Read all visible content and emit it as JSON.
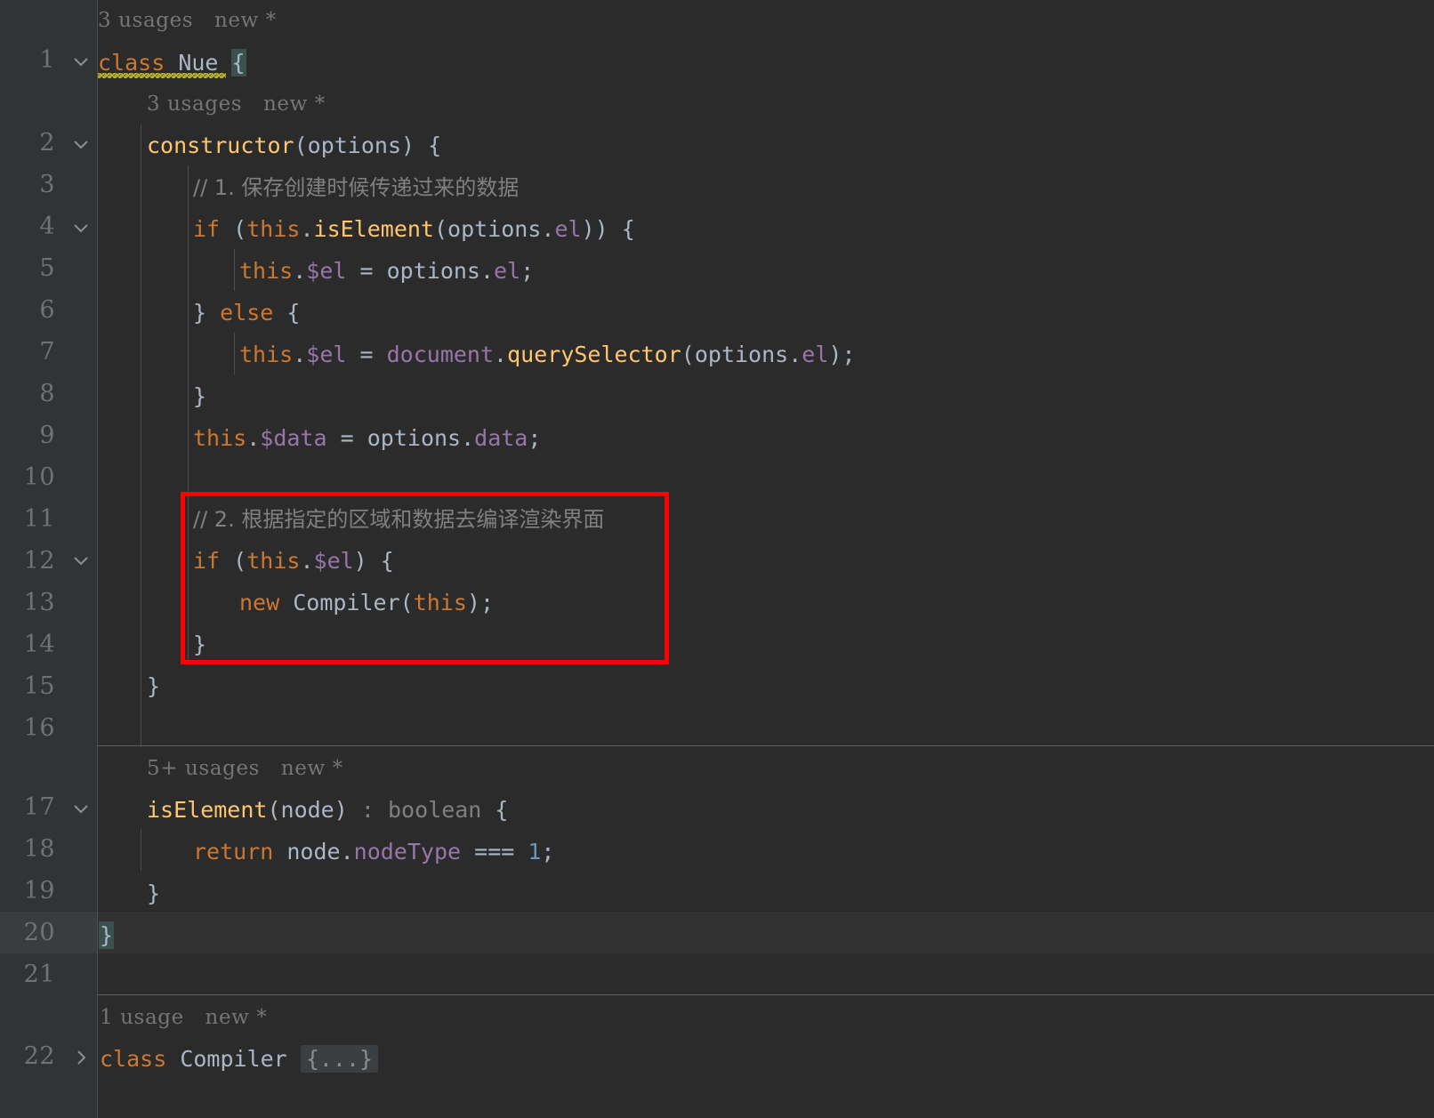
{
  "editor": {
    "theme": "darcula",
    "background_color": "#2b2b2b",
    "gutter_color": "#313335",
    "caret_line_color": "#323232",
    "annotation_color": "#fe0000",
    "language": "javascript"
  },
  "gutter": {
    "line_numbers": [
      "1",
      "2",
      "3",
      "4",
      "5",
      "6",
      "7",
      "8",
      "9",
      "10",
      "11",
      "12",
      "13",
      "14",
      "15",
      "16",
      "17",
      "18",
      "19",
      "20",
      "21",
      "22"
    ],
    "fold_expanded_lines": [
      "1",
      "2",
      "4",
      "12",
      "17"
    ],
    "fold_collapsed_lines": [
      "22"
    ]
  },
  "inlay_hints": [
    {
      "id": "hint-class-nue",
      "usages": "3 usages",
      "new": "new *"
    },
    {
      "id": "hint-constructor",
      "usages": "3 usages",
      "new": "new *"
    },
    {
      "id": "hint-iselement",
      "usages": "5+ usages",
      "new": "new *"
    },
    {
      "id": "hint-class-compiler",
      "usages": "1 usage",
      "new": "new *"
    }
  ],
  "code_lines": {
    "l1": "class Nue {",
    "l2": "constructor(options) {",
    "l3": "// 1. 保存创建时候传递过来的数据",
    "l4": "if (this.isElement(options.el)) {",
    "l5": "this.$el = options.el;",
    "l6": "} else {",
    "l7": "this.$el = document.querySelector(options.el);",
    "l8": "}",
    "l9": "this.$data = options.data;",
    "l10": "",
    "l11": "// 2. 根据指定的区域和数据去编译渲染界面",
    "l12": "if (this.$el) {",
    "l13": "new Compiler(this);",
    "l14": "}",
    "l15": "}",
    "l16": "",
    "l17": "isElement(node) : boolean {",
    "l18": "return node.nodeType === 1;",
    "l19": "}",
    "l20": "}",
    "l21": "",
    "l22": "class Compiler {...}"
  },
  "tokens": {
    "kw_class": "class",
    "kw_if": "if",
    "kw_else": "else",
    "kw_new": "new",
    "kw_return": "return",
    "kw_this": "this",
    "name_nue": "Nue",
    "name_constructor": "constructor",
    "name_options": "options",
    "name_isElement": "isElement",
    "name_el": "el",
    "name_dollar_el": "$el",
    "name_dollar_data": "$data",
    "name_data": "data",
    "name_document": "document",
    "name_querySelector": "querySelector",
    "name_compiler": "Compiler",
    "name_node": "node",
    "name_nodeType": "nodeType",
    "type_boolean": "boolean",
    "num_one": "1",
    "op_assign": "=",
    "op_strict_eq": "===",
    "semi": ";",
    "colon": ":",
    "dot": ".",
    "lparen": "(",
    "rparen": ")",
    "lbrace": "{",
    "rbrace": "}",
    "folded_placeholder": "{...}",
    "comment_1": "// 1. 保存创建时候传递过来的数据",
    "comment_2": "// 2. 根据指定的区域和数据去编译渲染界面",
    "comment_slashes": "//",
    "comment_1_text": "1. 保存创建时候传递过来的数据",
    "comment_2_text": "2. 根据指定的区域和数据去编译渲染界面"
  }
}
